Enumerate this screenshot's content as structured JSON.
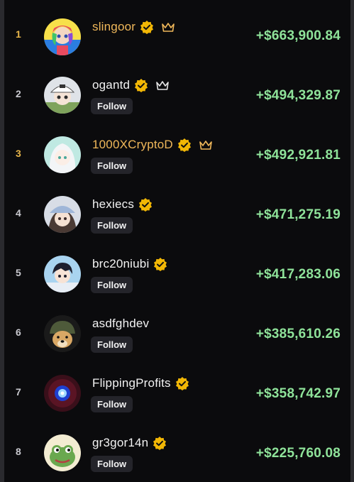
{
  "colors": {
    "profit": "#8fe39a",
    "verified": "#f2b705",
    "gold": "#f0b85a"
  },
  "follow_label": "Follow",
  "traders": [
    {
      "rank": "1",
      "name": "slingoor",
      "verified": true,
      "crown": true,
      "follow": false,
      "profit": "+$663,900.84",
      "avatar_icon": "anime-girl-colorful-avatar"
    },
    {
      "rank": "2",
      "name": "ogantd",
      "verified": true,
      "crown": true,
      "follow": true,
      "profit": "+$494,329.87",
      "avatar_icon": "anime-boy-hat-avatar"
    },
    {
      "rank": "3",
      "name": "1000XCryptoD",
      "verified": true,
      "crown": true,
      "follow": true,
      "profit": "+$492,921.81",
      "avatar_icon": "anime-girl-white-hair-avatar"
    },
    {
      "rank": "4",
      "name": "hexiecs",
      "verified": true,
      "crown": false,
      "follow": true,
      "profit": "+$471,275.19",
      "avatar_icon": "anime-girl-cap-avatar"
    },
    {
      "rank": "5",
      "name": "brc20niubi",
      "verified": true,
      "crown": false,
      "follow": true,
      "profit": "+$417,283.06",
      "avatar_icon": "anime-boy-dark-hair-avatar"
    },
    {
      "rank": "6",
      "name": "asdfghdev",
      "verified": false,
      "crown": false,
      "follow": true,
      "profit": "+$385,610.26",
      "avatar_icon": "dog-helmet-avatar"
    },
    {
      "rank": "7",
      "name": "FlippingProfits",
      "verified": true,
      "crown": false,
      "follow": true,
      "profit": "+$358,742.97",
      "avatar_icon": "glowing-eye-avatar"
    },
    {
      "rank": "8",
      "name": "gr3gor14n",
      "verified": true,
      "crown": false,
      "follow": true,
      "profit": "+$225,760.08",
      "avatar_icon": "frog-avatar"
    }
  ]
}
